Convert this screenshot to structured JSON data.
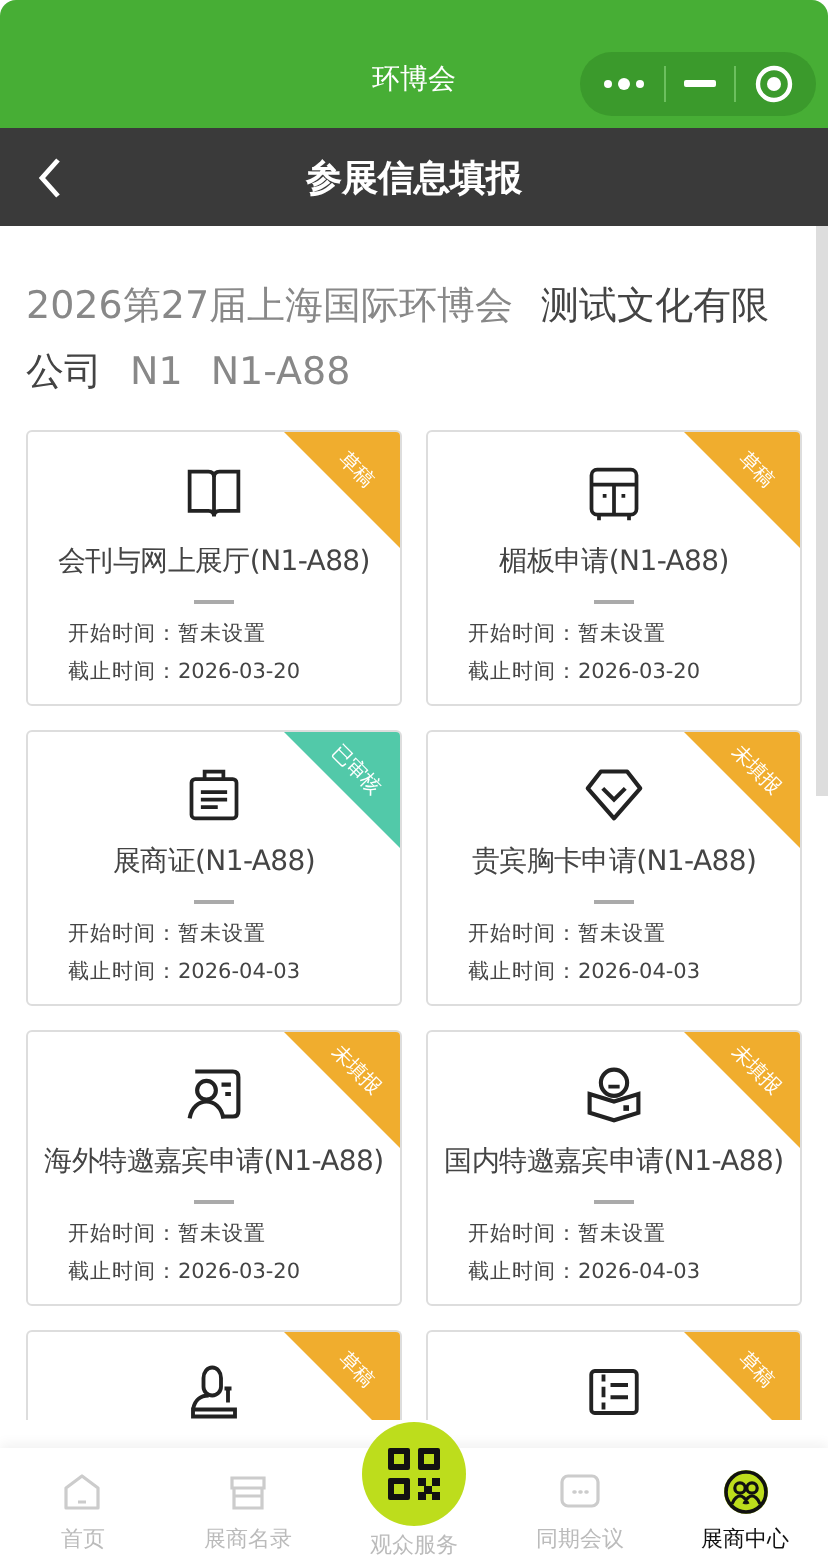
{
  "window": {
    "title": "环博会"
  },
  "header": {
    "title": "参展信息填报"
  },
  "heading": {
    "exhibition": "2026第27届上海国际环博会",
    "company": "测试文化有限公司",
    "hall": "N1",
    "booth": "N1-A88"
  },
  "cards": [
    {
      "title": "会刊与网上展厅(N1-A88)",
      "start": "开始时间：暂未设置",
      "end": "截止时间：2026-03-20",
      "status": "草稿",
      "color": "#f0ad2e"
    },
    {
      "title": "楣板申请(N1-A88)",
      "start": "开始时间：暂未设置",
      "end": "截止时间：2026-03-20",
      "status": "草稿",
      "color": "#f0ad2e"
    },
    {
      "title": "展商证(N1-A88)",
      "start": "开始时间：暂未设置",
      "end": "截止时间：2026-04-03",
      "status": "已审核",
      "color": "#52c9a9"
    },
    {
      "title": "贵宾胸卡申请(N1-A88)",
      "start": "开始时间：暂未设置",
      "end": "截止时间：2026-04-03",
      "status": "未填报",
      "color": "#f0ad2e"
    },
    {
      "title": "海外特邀嘉宾申请(N1-A88)",
      "start": "开始时间：暂未设置",
      "end": "截止时间：2026-03-20",
      "status": "未填报",
      "color": "#f0ad2e"
    },
    {
      "title": "国内特邀嘉宾申请(N1-A88)",
      "start": "开始时间：暂未设置",
      "end": "截止时间：2026-04-03",
      "status": "未填报",
      "color": "#f0ad2e"
    },
    {
      "status": "草稿",
      "color": "#f0ad2e"
    },
    {
      "status": "草稿",
      "color": "#f0ad2e"
    }
  ],
  "tabbar": [
    {
      "label": "首页",
      "selected": false
    },
    {
      "label": "展商名录",
      "selected": false
    },
    {
      "label": "观众服务",
      "selected": false,
      "kind": "center"
    },
    {
      "label": "同期会议",
      "selected": false
    },
    {
      "label": "展商中心",
      "selected": true
    }
  ]
}
